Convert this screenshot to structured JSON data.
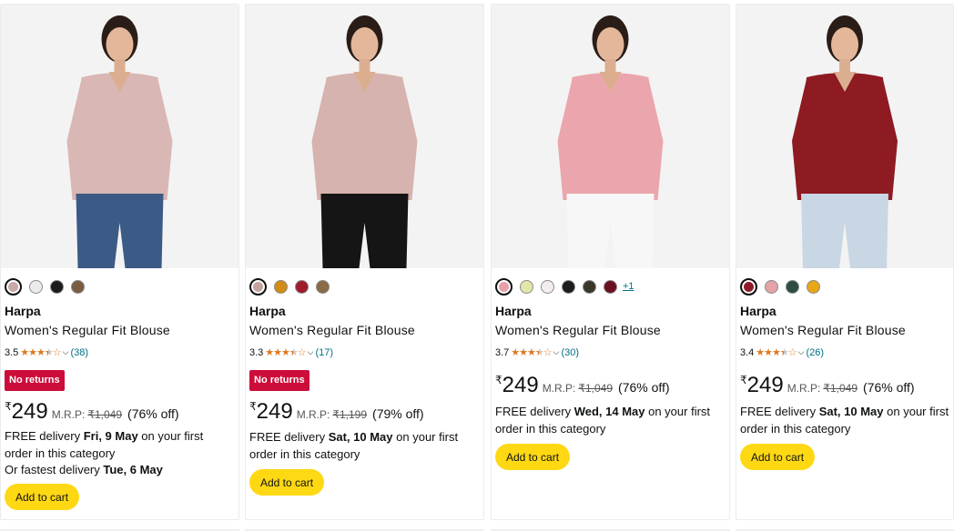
{
  "products": [
    {
      "swatch_colors": [
        "#c9a8a8",
        "#ebebee",
        "#1c1c1c",
        "#7a5c3e"
      ],
      "brand": "Harpa",
      "title": "Women's Regular Fit Blouse",
      "rating": "3.5",
      "reviews": "(38)",
      "badge": "No returns",
      "currency": "₹",
      "price": "249",
      "mrp_label": "M.R.P:",
      "mrp": "₹1,049",
      "discount": "(76% off)",
      "delivery_prefix": "FREE delivery ",
      "delivery_date": "Fri, 9 May",
      "delivery_suffix": " on your first order in this category",
      "fastest_prefix": "Or fastest delivery ",
      "fastest_date": "Tue, 6 May",
      "cart_label": "Add to cart",
      "garment_color": "#d9b7b5",
      "pants_color": "#3c5a86"
    },
    {
      "swatch_colors": [
        "#c4a39f",
        "#d08c14",
        "#a01c2c",
        "#8a6b45"
      ],
      "brand": "Harpa",
      "title": "Women's Regular Fit Blouse",
      "rating": "3.3",
      "reviews": "(17)",
      "badge": "No returns",
      "currency": "₹",
      "price": "249",
      "mrp_label": "M.R.P:",
      "mrp": "₹1,199",
      "discount": "(79% off)",
      "delivery_prefix": "FREE delivery ",
      "delivery_date": "Sat, 10 May",
      "delivery_suffix": " on your first order in this category",
      "cart_label": "Add to cart",
      "garment_color": "#d6b3ae",
      "pants_color": "#151515"
    },
    {
      "swatch_colors": [
        "#e6a0a8",
        "#e3e6a8",
        "#f4eded",
        "#1c1c1c",
        "#3b3728",
        "#6b0f22"
      ],
      "more_colors": "+1",
      "brand": "Harpa",
      "title": "Women's Regular Fit Blouse",
      "rating": "3.7",
      "reviews": "(30)",
      "currency": "₹",
      "price": "249",
      "mrp_label": "M.R.P:",
      "mrp": "₹1,049",
      "discount": "(76% off)",
      "delivery_prefix": "FREE delivery ",
      "delivery_date": "Wed, 14 May",
      "delivery_suffix": " on your first order in this category",
      "cart_label": "Add to cart",
      "garment_color": "#eba6ad",
      "pants_color": "#f7f7f7"
    },
    {
      "swatch_colors": [
        "#8e1a2a",
        "#e4a3a6",
        "#2e4d43",
        "#e8a714"
      ],
      "brand": "Harpa",
      "title": "Women's Regular Fit Blouse",
      "rating": "3.4",
      "reviews": "(26)",
      "currency": "₹",
      "price": "249",
      "mrp_label": "M.R.P:",
      "mrp": "₹1,049",
      "discount": "(76% off)",
      "delivery_prefix": "FREE delivery ",
      "delivery_date": "Sat, 10 May",
      "delivery_suffix": " on your first order in this category",
      "cart_label": "Add to cart",
      "garment_color": "#8e1a22",
      "pants_color": "#c9d6e3"
    }
  ]
}
